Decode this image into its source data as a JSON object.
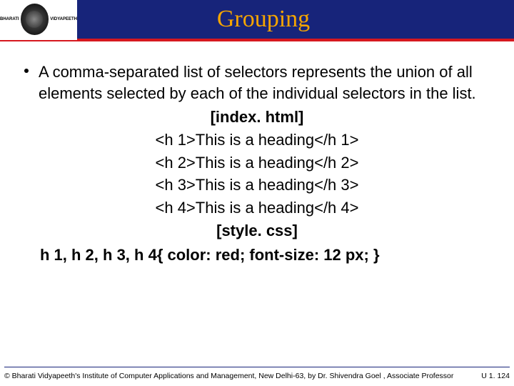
{
  "header": {
    "logo_left": "BHARATI",
    "logo_right": "VIDYAPEETH",
    "title": "Grouping"
  },
  "content": {
    "bullet": "A comma-separated list of selectors represents the union of all elements selected by each of the individual selectors in the list.",
    "label_index": "[index. html]",
    "code_h1": "<h 1>This is a heading</h 1>",
    "code_h2": "<h 2>This is a heading</h 2>",
    "code_h3": "<h 3>This is a heading</h 3>",
    "code_h4": "<h 4>This is a heading</h 4>",
    "label_style": "[style. css]",
    "css_rule": "h 1, h 2, h 3, h 4{ color: red; font-size: 12 px; }"
  },
  "footer": {
    "copyright": "© Bharati Vidyapeeth's Institute of Computer Applications and Management, New Delhi-63, by Dr. Shivendra Goel , Associate Professor",
    "page": "U 1. 124"
  }
}
